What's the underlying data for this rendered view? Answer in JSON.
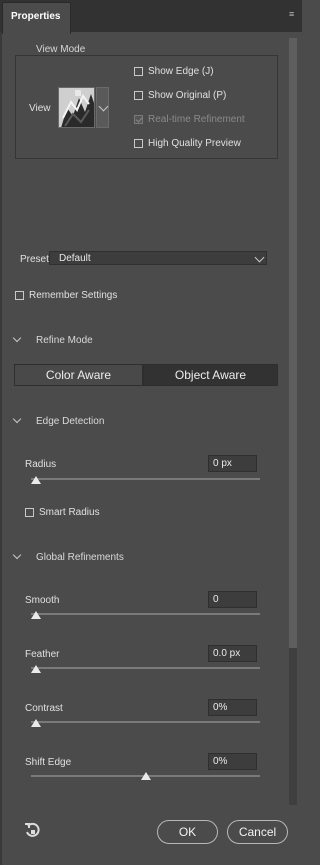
{
  "tab": {
    "title": "Properties"
  },
  "view_mode": {
    "group_label": "View Mode",
    "view_label": "View",
    "options": [
      {
        "label": "Show Edge (J)",
        "checked": false,
        "enabled": true
      },
      {
        "label": "Show Original (P)",
        "checked": false,
        "enabled": true
      },
      {
        "label": "Real-time Refinement",
        "checked": true,
        "enabled": false
      },
      {
        "label": "High Quality Preview",
        "checked": false,
        "enabled": true
      }
    ]
  },
  "preset": {
    "label": "Preset",
    "value": "Default"
  },
  "remember": {
    "label": "Remember Settings",
    "checked": false
  },
  "refine_mode": {
    "title": "Refine Mode",
    "options": [
      "Color Aware",
      "Object Aware"
    ],
    "selected": "Object Aware"
  },
  "edge_detection": {
    "title": "Edge Detection",
    "radius": {
      "label": "Radius",
      "value": "0 px",
      "fraction": 0.0
    },
    "smart_radius": {
      "label": "Smart Radius",
      "checked": false
    }
  },
  "global_refinements": {
    "title": "Global Refinements",
    "sliders": [
      {
        "key": "smooth",
        "label": "Smooth",
        "value": "0",
        "fraction": 0.0
      },
      {
        "key": "feather",
        "label": "Feather",
        "value": "0.0 px",
        "fraction": 0.0
      },
      {
        "key": "contrast",
        "label": "Contrast",
        "value": "0%",
        "fraction": 0.0
      },
      {
        "key": "shift_edge",
        "label": "Shift Edge",
        "value": "0%",
        "fraction": 0.5
      }
    ]
  },
  "footer": {
    "ok": "OK",
    "cancel": "Cancel",
    "reset_icon": "reset-icon"
  },
  "colors": {
    "panel": "#4b4b4b",
    "field": "#3d3d3d",
    "accent_selected": "#323232"
  }
}
